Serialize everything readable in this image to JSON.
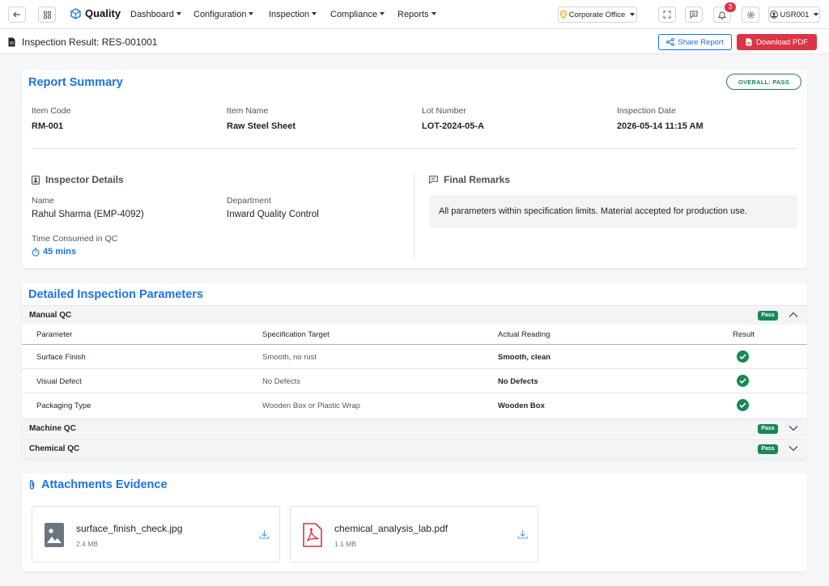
{
  "topbar": {
    "brand": "Quality",
    "nav": [
      "Dashboard",
      "Configuration",
      "Inspection",
      "Compliance",
      "Reports"
    ],
    "office": "Corporate Office",
    "notifications": "3",
    "user": "USR001"
  },
  "subheader": {
    "title": "Inspection Result: RES-001001",
    "share_label": "Share Report",
    "download_label": "Download PDF"
  },
  "summary": {
    "title": "Report Summary",
    "overall": "OVERALL: PASS",
    "fields": [
      {
        "label": "Item Code",
        "value": "RM-001"
      },
      {
        "label": "Item Name",
        "value": "Raw Steel Sheet"
      },
      {
        "label": "Lot Number",
        "value": "LOT-2024-05-A"
      },
      {
        "label": "Inspection Date",
        "value": "2026-05-14 11:15 AM"
      }
    ],
    "inspector": {
      "title": "Inspector Details",
      "name_label": "Name",
      "name": "Rahul Sharma (EMP-4092)",
      "dept_label": "Department",
      "dept": "Inward Quality Control",
      "time_label": "Time Consumed in QC",
      "time": "45 mins"
    },
    "remarks": {
      "title": "Final Remarks",
      "text": "All parameters within specification limits. Material accepted for production use."
    }
  },
  "params": {
    "title": "Detailed Inspection Parameters",
    "sections": [
      {
        "label": "Manual QC",
        "status": "Pass",
        "expanded": true
      },
      {
        "label": "Machine QC",
        "status": "Pass",
        "expanded": false
      },
      {
        "label": "Chemical QC",
        "status": "Pass",
        "expanded": false
      }
    ],
    "columns": [
      "Parameter",
      "Specification Target",
      "Actual Reading",
      "Result"
    ],
    "rows": [
      {
        "param": "Surface Finish",
        "target": "Smooth, no rust",
        "reading": "Smooth, clean"
      },
      {
        "param": "Visual Defect",
        "target": "No Defects",
        "reading": "No Defects"
      },
      {
        "param": "Packaging Type",
        "target": "Wooden Box or Plastic Wrap",
        "reading": "Wooden Box"
      }
    ]
  },
  "attachments": {
    "title": "Attachments Evidence",
    "files": [
      {
        "name": "surface_finish_check.jpg",
        "size": "2.4 MB",
        "icon": "image-file-icon"
      },
      {
        "name": "chemical_analysis_lab.pdf",
        "size": "1.1 MB",
        "icon": "pdf-file-icon"
      }
    ]
  },
  "colors": {
    "primary": "#1a73e8",
    "success": "#198754",
    "danger": "#dc3545"
  }
}
